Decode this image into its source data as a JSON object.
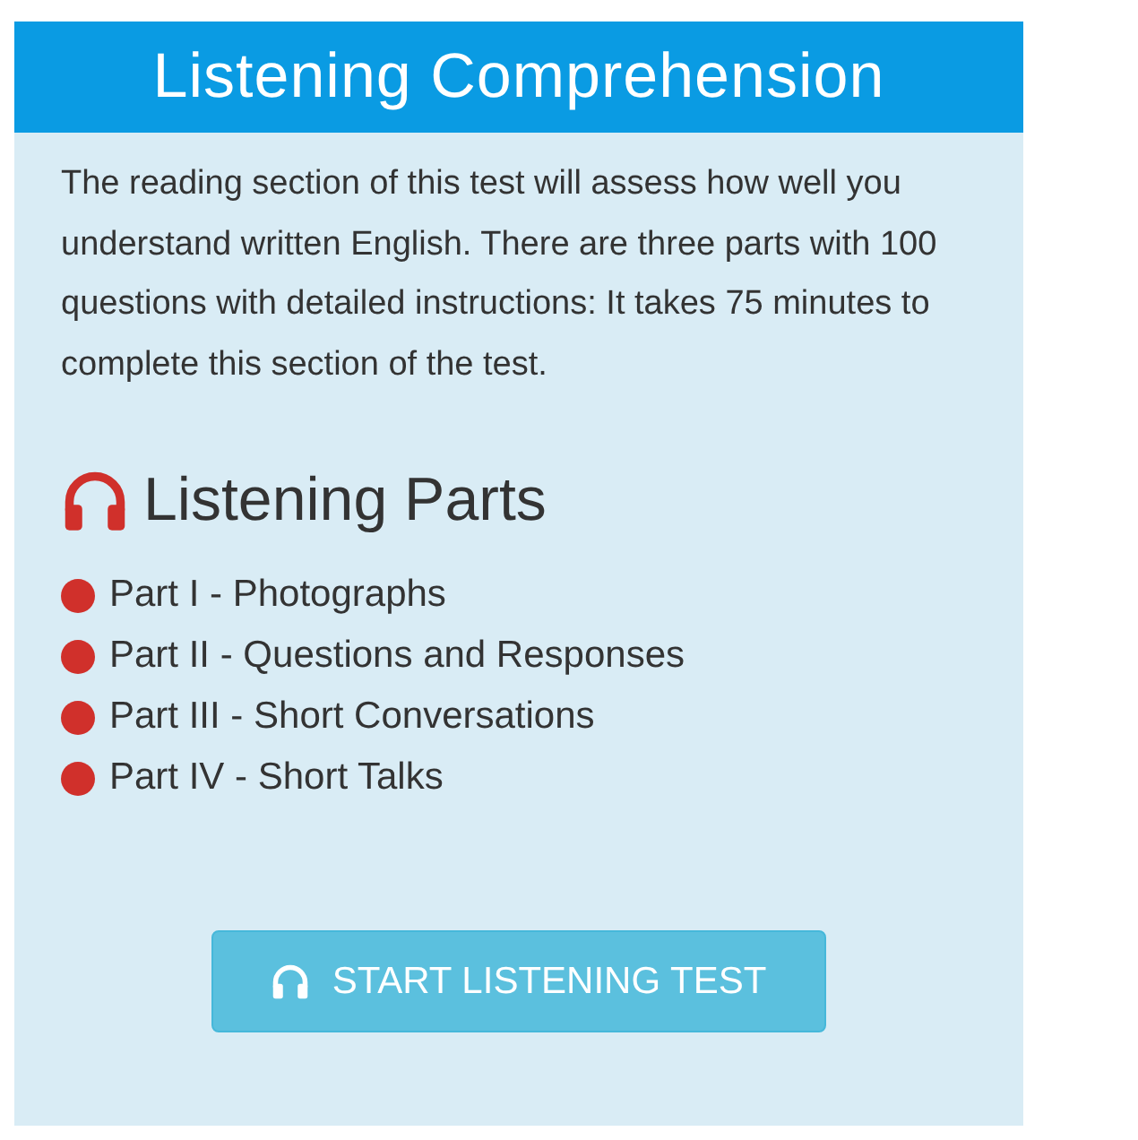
{
  "header": {
    "title": "Listening Comprehension"
  },
  "intro": "The reading section of this test will assess how well you understand written English. There are three parts with 100 questions with detailed instructions: It takes 75 minutes to complete this section of the test.",
  "parts": {
    "heading": "Listening Parts",
    "items": [
      {
        "label": "Part I - Photographs"
      },
      {
        "label": "Part II - Questions and Responses"
      },
      {
        "label": "Part III - Short Conversations"
      },
      {
        "label": "Part IV - Short Talks"
      }
    ]
  },
  "start_button": {
    "label": "START LISTENING TEST"
  }
}
